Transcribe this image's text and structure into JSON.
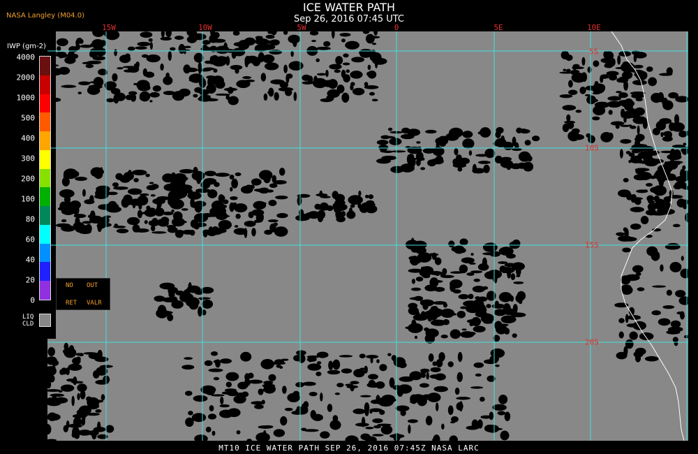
{
  "header": {
    "title": "ICE WATER PATH",
    "subtitle": "Sep 26, 2016 07:45 UTC",
    "org": "NASA Langley (M04.0)"
  },
  "legend": {
    "unit_label": "IWP (gm-2)",
    "ticks": [
      "4000",
      "2000",
      "1000",
      "500",
      "400",
      "300",
      "200",
      "100",
      "80",
      "60",
      "40",
      "20",
      "0"
    ],
    "colors": [
      "#6b1010",
      "#c80000",
      "#ff0000",
      "#ff5a00",
      "#ffa500",
      "#ffff00",
      "#88e000",
      "#00b000",
      "#00885a",
      "#00ffff",
      "#0090ff",
      "#2020ff",
      "#9030e0"
    ],
    "no_ret": [
      "NO",
      "RET"
    ],
    "out_valr": [
      "OUT",
      "VALR"
    ],
    "liq_cld": [
      "LIQ",
      "CLD"
    ]
  },
  "map": {
    "lon_labels": [
      "15W",
      "10W",
      "5W",
      "0",
      "5E",
      "10E"
    ],
    "lat_labels": [
      "5S",
      "10S",
      "15S",
      "20S"
    ],
    "grid_color": "#40e0e0",
    "cloud_free_color": "#000000",
    "liquid_cloud_color": "#888888"
  },
  "footer": {
    "text": "MT10   ICE WATER PATH   SEP 26, 2016 07:45Z   NASA LARC"
  }
}
